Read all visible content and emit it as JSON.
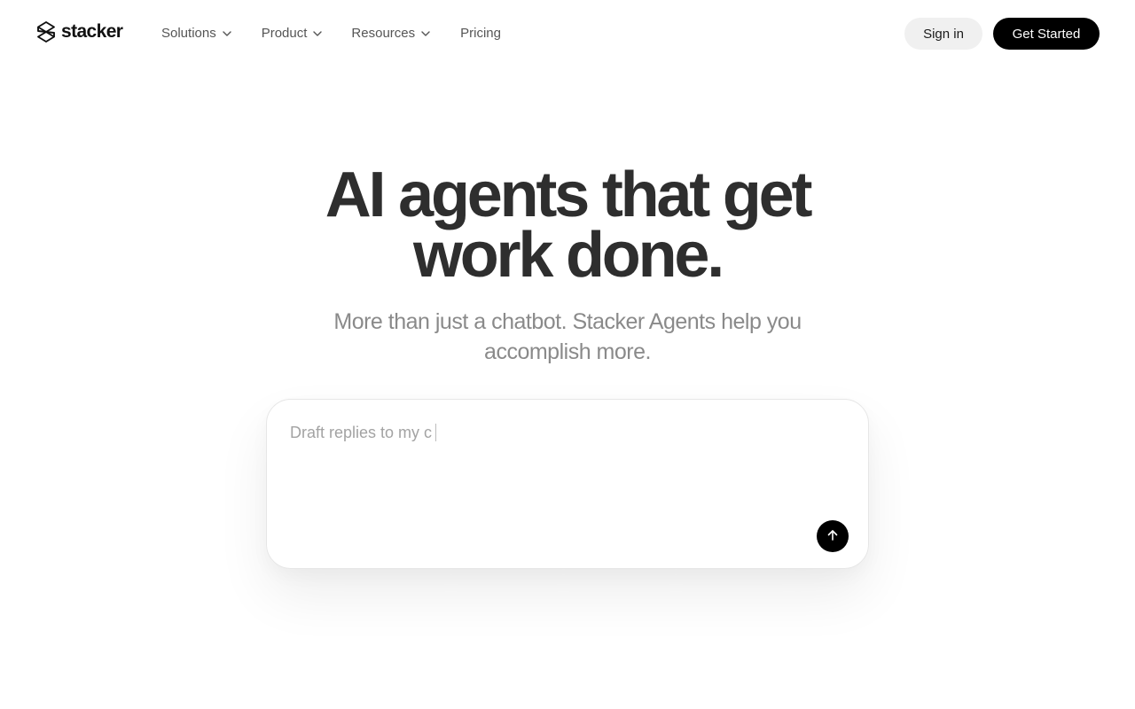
{
  "brand": {
    "name": "stacker",
    "logo_icon": "stacker-logo-icon"
  },
  "nav": {
    "items": [
      {
        "label": "Solutions",
        "has_dropdown": true
      },
      {
        "label": "Product",
        "has_dropdown": true
      },
      {
        "label": "Resources",
        "has_dropdown": true
      },
      {
        "label": "Pricing",
        "has_dropdown": false
      }
    ]
  },
  "header_actions": {
    "sign_in": "Sign in",
    "get_started": "Get Started"
  },
  "hero": {
    "title_line1": "AI agents that get",
    "title_line2": "work done.",
    "subtitle_line1": "More than just a chatbot. Stacker Agents help you",
    "subtitle_line2": "accomplish more."
  },
  "prompt": {
    "typed_text": "Draft replies to my c",
    "send_icon": "arrow-up-icon"
  },
  "colors": {
    "primary_button": "#000000",
    "secondary_button": "#f0f0f0",
    "title_text": "#2e2e2e",
    "subtitle_text": "#8a8a8a",
    "nav_text": "#555555"
  }
}
